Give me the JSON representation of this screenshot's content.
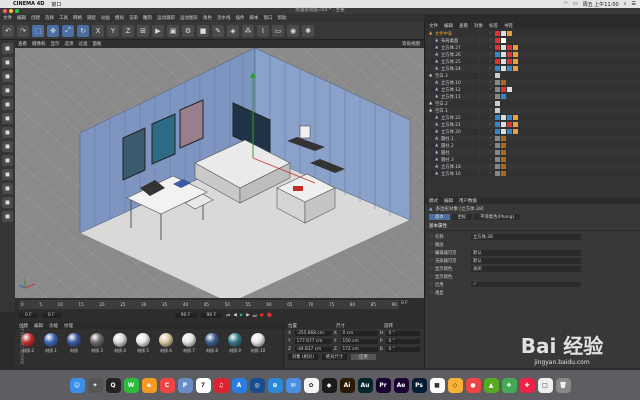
{
  "mac": {
    "app_name": "CINEMA 4D",
    "menu": [
      "窗口"
    ],
    "datetime": "周五 上午11:00"
  },
  "window": {
    "title": "绘画层动画.c4d * - 主要"
  },
  "menubar": [
    "文件",
    "编辑",
    "创建",
    "选择",
    "工具",
    "网格",
    "捕捉",
    "动画",
    "模拟",
    "渲染",
    "雕刻",
    "运动跟踪",
    "运动图形",
    "角色",
    "流水线",
    "插件",
    "脚本",
    "窗口",
    "帮助"
  ],
  "toolbar": {
    "icons": [
      "undo-icon",
      "redo-icon",
      "live-select-icon",
      "move-icon",
      "scale-icon",
      "rotate-icon",
      "x-axis-icon",
      "y-axis-icon",
      "z-axis-icon",
      "coord-system-icon",
      "render-view-icon",
      "render-picture-icon",
      "render-settings-icon",
      "cube-icon",
      "pen-icon",
      "subdivision-icon",
      "array-icon",
      "deformer-icon",
      "floor-icon",
      "camera-icon",
      "light-icon"
    ],
    "axis_labels": [
      "X",
      "Y",
      "Z"
    ]
  },
  "left_tools": [
    "model-mode-icon",
    "texture-mode-icon",
    "points-mode-icon",
    "edges-mode-icon",
    "polygons-mode-icon",
    "axis-mode-icon",
    "tweak-icon",
    "snap-icon",
    "workplane-icon",
    "solo-icon",
    "lock-icon",
    "grid-icon",
    "magnet-icon"
  ],
  "viewport_menu": [
    "查看",
    "摄像机",
    "显示",
    "选项",
    "过滤",
    "面板"
  ],
  "viewport": {
    "mode_label": "等角视图"
  },
  "timeline": {
    "ticks": [
      "0",
      "5",
      "10",
      "15",
      "20",
      "25",
      "30",
      "35",
      "40",
      "45",
      "50",
      "55",
      "60",
      "65",
      "70",
      "75",
      "80",
      "85",
      "90"
    ],
    "current_frame": "0 F",
    "start_field": "0 F",
    "end_field": "90 F",
    "end_field2": "90 F",
    "frame_readout": "0 F"
  },
  "materials": {
    "menu": [
      "创建",
      "编辑",
      "功能",
      "纹理"
    ],
    "items": [
      {
        "label": "材质.2",
        "color": "#c42c2c"
      },
      {
        "label": "材质.1",
        "color": "#3f67b8"
      },
      {
        "label": "材质",
        "color": "#3c5ea6"
      },
      {
        "label": "材质.3",
        "color": "#6d6d6d"
      },
      {
        "label": "材质.4",
        "color": "#d8d8d8"
      },
      {
        "label": "材质.5",
        "color": "#e8e8e8"
      },
      {
        "label": "材质.6",
        "color": "#d6c8a0"
      },
      {
        "label": "材质.7",
        "color": "#e5e5e5"
      },
      {
        "label": "材质.8",
        "color": "#3b5e8c"
      },
      {
        "label": "材质.9",
        "color": "#3a7a8a"
      },
      {
        "label": "材质.10",
        "color": "#e6e6e6"
      }
    ],
    "watermark": "MAXON CINEMA 4D"
  },
  "coords": {
    "headers": [
      "位置",
      "尺寸",
      "旋转"
    ],
    "rows": [
      {
        "axis": "X",
        "pos": "-255.668 cm",
        "size": "0 cm",
        "rot_label": "H",
        "rot": "0 °"
      },
      {
        "axis": "Y",
        "pos": "177.677 cm",
        "size": "150 cm",
        "rot_label": "P",
        "rot": "0 °"
      },
      {
        "axis": "Z",
        "pos": "-44.837 cm",
        "size": "172 cm",
        "rot_label": "B",
        "rot": "0 °"
      }
    ],
    "mode_select": "对象 (相对)",
    "size_select": "绝对尺寸",
    "apply_button": "应用"
  },
  "objects": {
    "tabs": [
      "文件",
      "编辑",
      "查看",
      "对象",
      "标签",
      "书签"
    ],
    "rows": [
      {
        "indent": 0,
        "name": "文件中表",
        "color": "#e6a13b",
        "tags": [
          "#d33",
          "#ddd",
          "#e7a03a"
        ]
      },
      {
        "indent": 1,
        "name": "布局桌面",
        "color": "#9ad",
        "tags": [
          "#d33",
          "#fff"
        ]
      },
      {
        "indent": 1,
        "name": "立方体.27",
        "color": "#9ad",
        "tags": [
          "#d33",
          "#ddd",
          "#d33",
          "#e7a03a"
        ]
      },
      {
        "indent": 1,
        "name": "立方体.26",
        "color": "#9ad",
        "tags": [
          "#38c",
          "#ddd",
          "#d33",
          "#e7a03a"
        ]
      },
      {
        "indent": 1,
        "name": "立方体.25",
        "color": "#9ad",
        "tags": [
          "#d33",
          "#ddd",
          "#d33",
          "#e7a03a"
        ]
      },
      {
        "indent": 1,
        "name": "立方体.24",
        "color": "#9ad",
        "tags": [
          "#38c",
          "#ddd",
          "#38c",
          "#e7a03a"
        ]
      },
      {
        "indent": 0,
        "name": "空白.3",
        "color": "#ccc",
        "tags": [
          "#ccc"
        ]
      },
      {
        "indent": 1,
        "name": "立方体.10",
        "color": "#9ad",
        "tags": [
          "#888",
          "#a62"
        ]
      },
      {
        "indent": 1,
        "name": "立方体.12",
        "color": "#9ad",
        "tags": [
          "#888",
          "#d33",
          "#ddd"
        ]
      },
      {
        "indent": 1,
        "name": "立方体.11",
        "color": "#9ad",
        "tags": [
          "#888",
          "#38c"
        ]
      },
      {
        "indent": 0,
        "name": "空白.2",
        "color": "#ccc",
        "tags": [
          "#ccc"
        ]
      },
      {
        "indent": 0,
        "name": "空白.1",
        "color": "#ccc",
        "tags": [
          "#ccc"
        ]
      },
      {
        "indent": 1,
        "name": "立方体.22",
        "color": "#9ad",
        "tags": [
          "#38c",
          "#ddd",
          "#38c",
          "#e7a03a"
        ]
      },
      {
        "indent": 1,
        "name": "立方体.21",
        "color": "#9ad",
        "tags": [
          "#38c",
          "#ddd",
          "#d33",
          "#e7a03a"
        ]
      },
      {
        "indent": 1,
        "name": "立方体.20",
        "color": "#9ad",
        "tags": [
          "#38c",
          "#ddd",
          "#38c",
          "#e7a03a"
        ]
      },
      {
        "indent": 1,
        "name": "圆柱.1",
        "color": "#9ad",
        "tags": [
          "#888",
          "#a62"
        ]
      },
      {
        "indent": 1,
        "name": "圆柱.2",
        "color": "#9ad",
        "tags": [
          "#888",
          "#a62"
        ]
      },
      {
        "indent": 1,
        "name": "圆柱",
        "color": "#9ad",
        "tags": [
          "#888",
          "#a62"
        ]
      },
      {
        "indent": 1,
        "name": "圆柱.3",
        "color": "#9ad",
        "tags": [
          "#888",
          "#a62"
        ]
      },
      {
        "indent": 1,
        "name": "立方体.18",
        "color": "#9ad",
        "tags": [
          "#888",
          "#a62"
        ]
      },
      {
        "indent": 1,
        "name": "立方体.16",
        "color": "#9ad",
        "tags": [
          "#888",
          "#a62"
        ]
      }
    ]
  },
  "attributes": {
    "tabs": [
      "模式",
      "编辑",
      "用户数据"
    ],
    "title": "多边形对象 [立方体.28]",
    "subtabs": [
      "基本",
      "坐标",
      "平滑着色(Phong)"
    ],
    "section": "基本属性",
    "fields": [
      {
        "label": "名称",
        "value": "立方体.28"
      },
      {
        "label": "图层",
        "value": ""
      },
      {
        "label": "编辑器可见",
        "value": "默认"
      },
      {
        "label": "渲染器可见",
        "value": "默认"
      },
      {
        "label": "显示颜色",
        "value": "关闭"
      },
      {
        "label": "显示颜色",
        "value": ""
      },
      {
        "label": "启用",
        "value": "✓"
      },
      {
        "label": "透显",
        "value": ""
      }
    ]
  },
  "watermark": {
    "brand": "Bai 经验",
    "url": "jingyan.baidu.com"
  },
  "dock": [
    {
      "name": "finder-icon",
      "color": "#3a8fe8",
      "glyph": "☺"
    },
    {
      "name": "launchpad-icon",
      "color": "#555",
      "glyph": "✦"
    },
    {
      "name": "qq-icon",
      "color": "#222",
      "glyph": "Q"
    },
    {
      "name": "wechat-icon",
      "color": "#2dbb3d",
      "glyph": "W"
    },
    {
      "name": "browser-icon",
      "color": "#f29a22",
      "glyph": "e"
    },
    {
      "name": "chrome-icon",
      "color": "#e44",
      "glyph": "C"
    },
    {
      "name": "preview-icon",
      "color": "#6a8cc7",
      "glyph": "P"
    },
    {
      "name": "calendar-icon",
      "color": "#fff",
      "glyph": "7"
    },
    {
      "name": "netease-music-icon",
      "color": "#d23",
      "glyph": "♫"
    },
    {
      "name": "appstore-icon",
      "color": "#2a7de1",
      "glyph": "A"
    },
    {
      "name": "c4d-icon",
      "color": "#1b4d8e",
      "glyph": "◎"
    },
    {
      "name": "safari-icon",
      "color": "#2b88d8",
      "glyph": "⊕"
    },
    {
      "name": "mail-icon",
      "color": "#4a90e2",
      "glyph": "✉"
    },
    {
      "name": "photos-icon",
      "color": "#f5f5f5",
      "glyph": "✿"
    },
    {
      "name": "app-icon",
      "color": "#1b1b1b",
      "glyph": "◆"
    },
    {
      "name": "illustrator-icon",
      "color": "#2a1a04",
      "glyph": "Ai"
    },
    {
      "name": "audition-icon",
      "color": "#00262a",
      "glyph": "Au"
    },
    {
      "name": "premiere-icon",
      "color": "#1a0033",
      "glyph": "Pr"
    },
    {
      "name": "aftereffects-icon",
      "color": "#1a0033",
      "glyph": "Ae"
    },
    {
      "name": "photoshop-icon",
      "color": "#001d34",
      "glyph": "Ps"
    },
    {
      "name": "app2-icon",
      "color": "#fff",
      "glyph": "■"
    },
    {
      "name": "sketch-icon",
      "color": "#f9b233",
      "glyph": "◇"
    },
    {
      "name": "app3-icon",
      "color": "#ee4444",
      "glyph": "●"
    },
    {
      "name": "app4-icon",
      "color": "#5a2",
      "glyph": "▲"
    },
    {
      "name": "app5-icon",
      "color": "#4a5",
      "glyph": "❖"
    },
    {
      "name": "app6-icon",
      "color": "#e24",
      "glyph": "✚"
    },
    {
      "name": "app7-icon",
      "color": "#eee",
      "glyph": "□"
    },
    {
      "name": "trash-icon",
      "color": "#888",
      "glyph": "🗑"
    }
  ]
}
